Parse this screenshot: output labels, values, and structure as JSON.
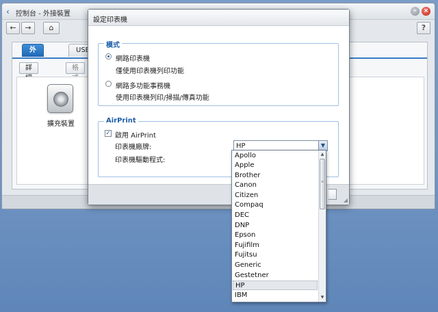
{
  "app": {
    "title": "控制台 - 外接裝置",
    "back_icon": "‹",
    "help_label": "?"
  },
  "nav": {
    "back": "←",
    "forward": "→",
    "home": "⌂"
  },
  "tabs": [
    {
      "label": "外接裝置",
      "active": true
    },
    {
      "label": "USB"
    }
  ],
  "sub_toolbar": {
    "details": "詳細資訊",
    "format": "格式"
  },
  "device": {
    "label": "擴充裝置"
  },
  "dialog": {
    "title": "設定印表機",
    "mode_section": {
      "legend": "模式",
      "options": [
        {
          "label": "網路印表機",
          "desc": "僅使用印表機列印功能",
          "selected": true
        },
        {
          "label": "網路多功能事務機",
          "desc": "使用印表機列印/掃描/傳真功能",
          "selected": false
        }
      ]
    },
    "airprint_section": {
      "legend": "AirPrint",
      "enable_label": "啟用 AirPrint",
      "enabled": true,
      "brand_label": "印表機廠牌:",
      "driver_label": "印表機驅動程式:",
      "brand_value": "HP"
    }
  },
  "dropdown": {
    "options": [
      "Apollo",
      "Apple",
      "Brother",
      "Canon",
      "Citizen",
      "Compaq",
      "DEC",
      "DNP",
      "Epson",
      "Fujifilm",
      "Fujitsu",
      "Generic",
      "Gestetner",
      "HP",
      "IBM"
    ],
    "selected_index": 13
  }
}
